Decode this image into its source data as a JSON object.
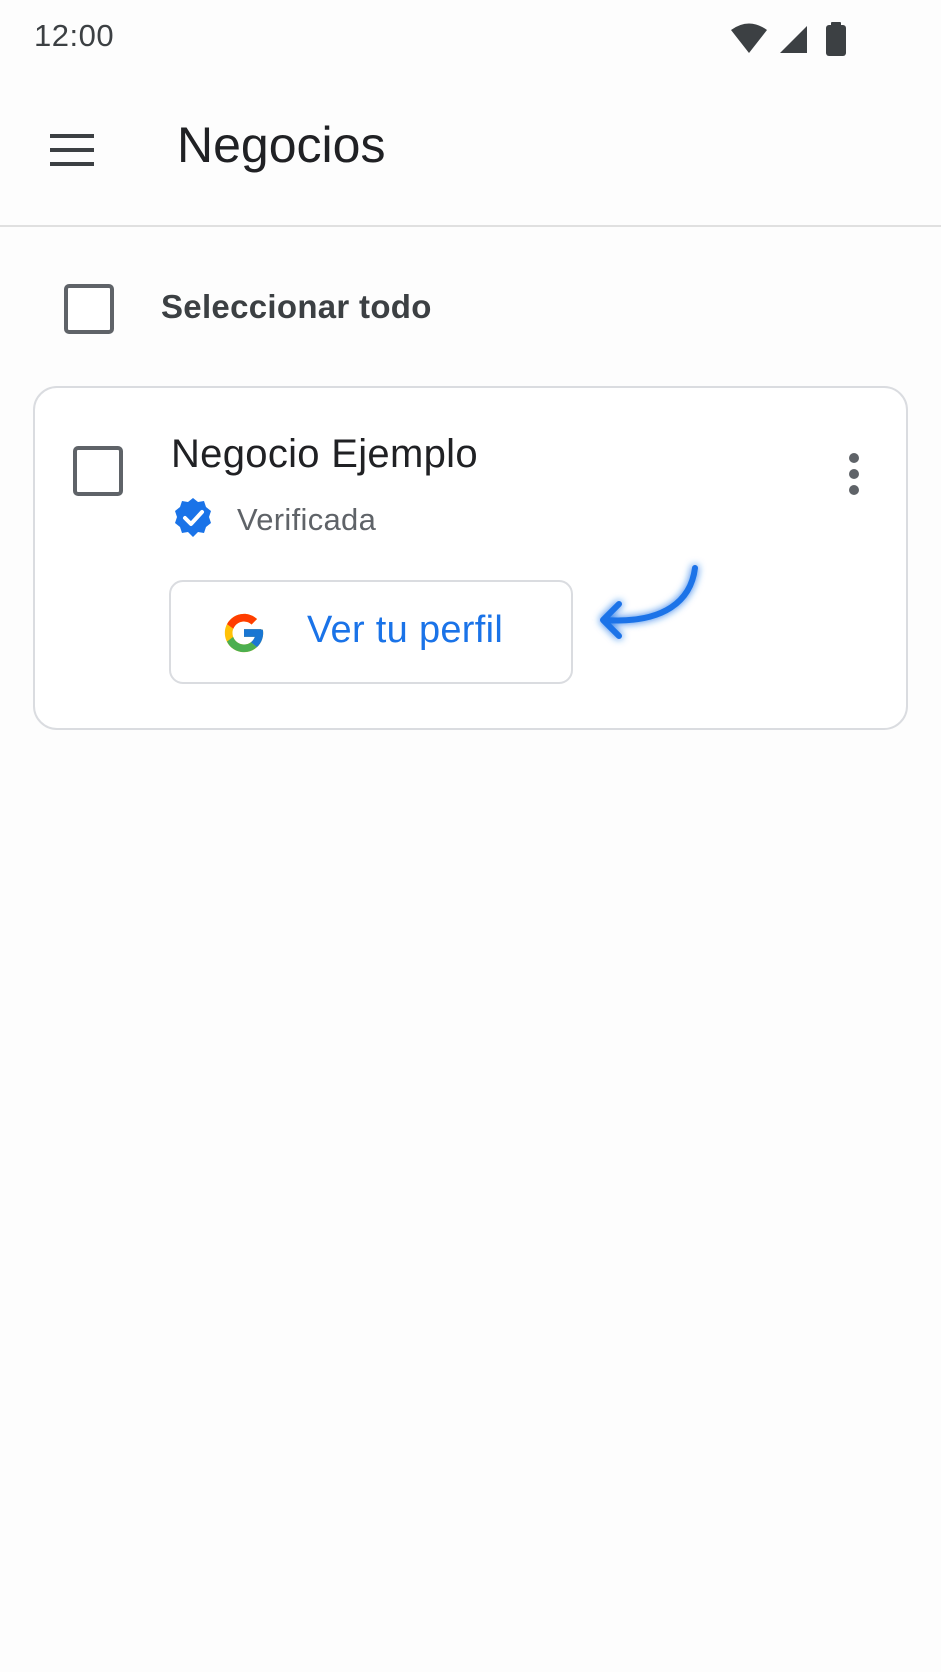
{
  "status_bar": {
    "time": "12:00",
    "icons": [
      "wifi-icon",
      "signal-icon",
      "battery-icon"
    ]
  },
  "app_bar": {
    "title": "Negocios",
    "menu_icon": "menu-icon"
  },
  "select_all": {
    "label": "Seleccionar todo",
    "checked": false
  },
  "business_card": {
    "name": "Negocio Ejemplo",
    "status": "Verificada",
    "status_icon": "verified-badge-icon",
    "checked": false,
    "more_icon": "more-vert-icon",
    "profile_button": {
      "label": "Ver tu perfil",
      "icon": "google-logo-icon"
    },
    "annotation_icon": "curved-arrow-icon"
  },
  "colors": {
    "accent": "#1a73e8",
    "text_primary": "#202124",
    "text_secondary": "#5f6368",
    "border": "#dadce0",
    "verified_badge": "#1a73e8"
  }
}
